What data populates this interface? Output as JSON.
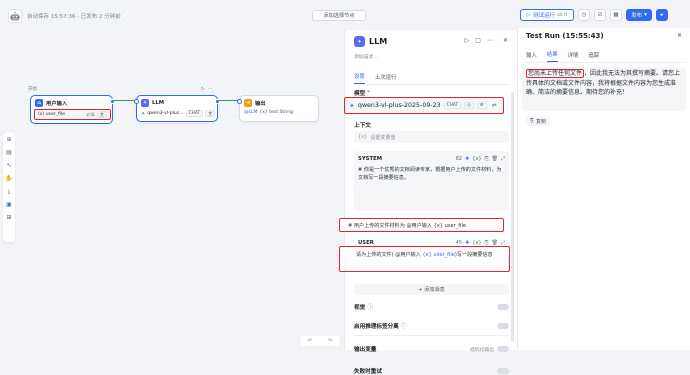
{
  "header": {
    "save_status": "自动保存 15:57:36 · 已发布 2 分钟前",
    "add_node_label": "添加选择节点",
    "run_label": "测试运行",
    "run_shortcut": "alt R",
    "publish_label": "发布"
  },
  "canvas": {
    "group_label": "开始",
    "start_node": {
      "title": "用户输入",
      "var_name": "(x) user_file",
      "required": "必填",
      "type": "文"
    },
    "llm_node": {
      "title": "LLM",
      "model": "qwen3-vl-plus...",
      "chip1": "CHAT",
      "chip2": "文"
    },
    "output_node": {
      "title": "输出",
      "ref": "@LLM",
      "ref_type": "{x} text String"
    }
  },
  "llm_panel": {
    "title": "LLM",
    "subtitle": "添加描述...",
    "tabs": [
      "设置",
      "上次运行"
    ],
    "model_label": "模型",
    "model_name": "qwen3-vl-plus-2025-09-23",
    "model_chip": "CHAT",
    "context_label": "上下文",
    "context_placeholder": "设置变量值",
    "system_label": "SYSTEM",
    "system_count": "82",
    "system_text": "# 你是一个优秀的文档阅读专家，根据用户上传的文件材料，为文档写一段摘要信息。",
    "system_line2": "# 用户上传的文件材料为 @用户输入 {x} user_file",
    "user_label": "USER",
    "user_count": "45",
    "user_text_pre": "请为上传的文件( @用户输入 ",
    "user_var": "{x} user_file",
    "user_text_post": ")写一段摘要信息",
    "add_message": "+ 添加消息",
    "vision_label": "视觉",
    "reasoning_label": "启用推理标签分离",
    "output_label": "输出变量",
    "output_right": "结构化输出",
    "retry_label": "失败时重试"
  },
  "run_panel": {
    "title": "Test Run (15:55:43)",
    "tabs": [
      "输入",
      "结果",
      "详情",
      "追踪"
    ],
    "result_highlight": "您尚未上传任何文件",
    "result_text": "，因此我无法为其撰写摘要。请您上传具体的文档或文件内容，我将根据文件内容为您生成准确、简洁的摘要信息。期待您的补充！",
    "copy_label": "复制"
  },
  "colors": {
    "accent": "#2f6bf2",
    "highlight": "#e3262e",
    "success": "#2f9a64"
  }
}
